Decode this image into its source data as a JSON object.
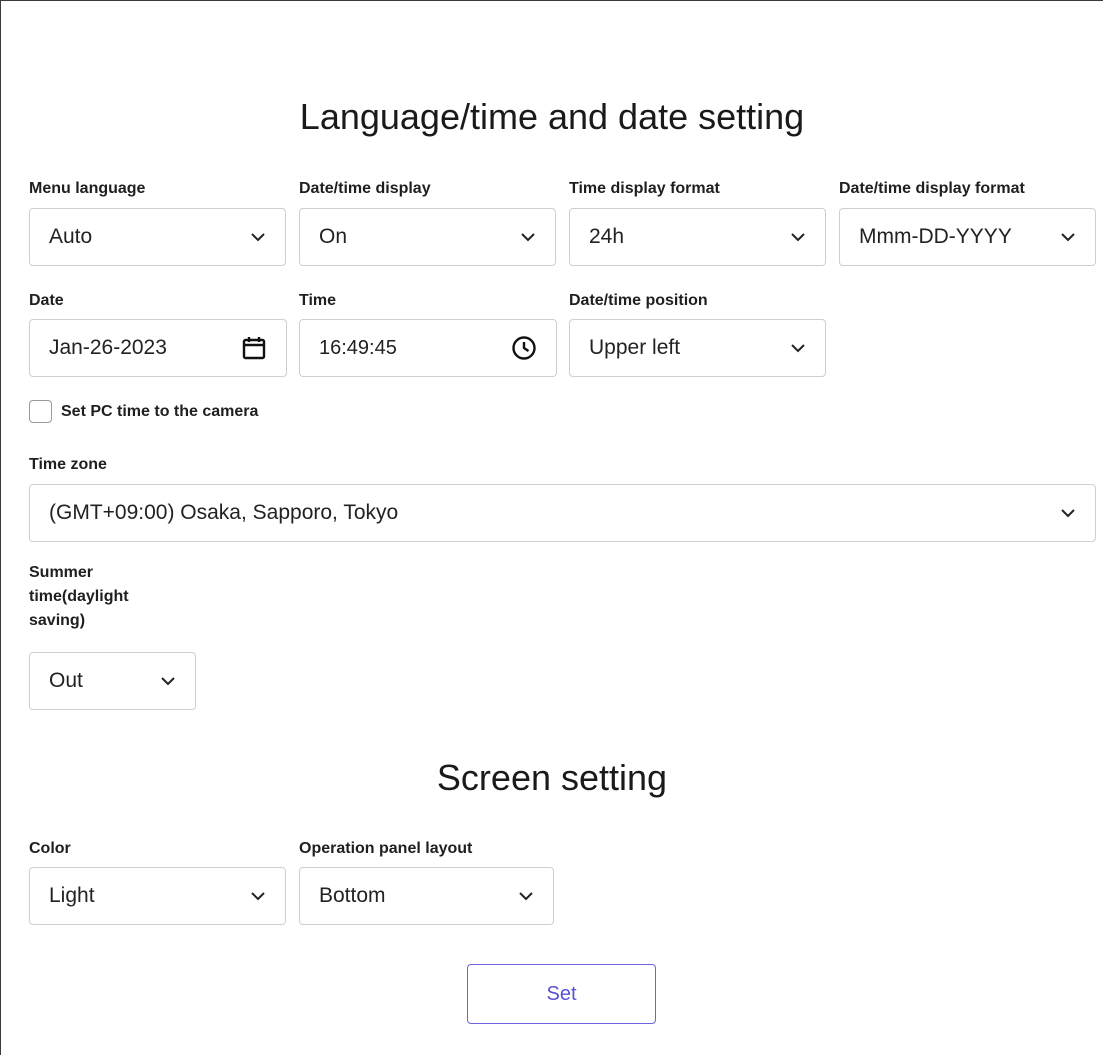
{
  "sections": {
    "language_title": "Language/time and date setting",
    "screen_title": "Screen setting"
  },
  "menu_language": {
    "label": "Menu language",
    "value": "Auto"
  },
  "datetime_display": {
    "label": "Date/time display",
    "value": "On"
  },
  "time_display_format": {
    "label": "Time display format",
    "value": "24h"
  },
  "datetime_display_format": {
    "label": "Date/time display format",
    "value": "Mmm-DD-YYYY"
  },
  "date": {
    "label": "Date",
    "value": "Jan-26-2023",
    "icon": "calendar-icon"
  },
  "time": {
    "label": "Time",
    "value": "16:49:45",
    "icon": "clock-icon"
  },
  "datetime_position": {
    "label": "Date/time position",
    "value": "Upper left"
  },
  "set_pc_time": {
    "label": "Set PC time to the camera",
    "checked": false
  },
  "time_zone": {
    "label": "Time zone",
    "value": "(GMT+09:00) Osaka, Sapporo, Tokyo"
  },
  "summer_time": {
    "label": "Summer time(daylight saving)",
    "value": "Out"
  },
  "color": {
    "label": "Color",
    "value": "Light"
  },
  "operation_panel_layout": {
    "label": "Operation panel layout",
    "value": "Bottom"
  },
  "set_button": {
    "label": "Set",
    "color": "#5a50d8"
  }
}
